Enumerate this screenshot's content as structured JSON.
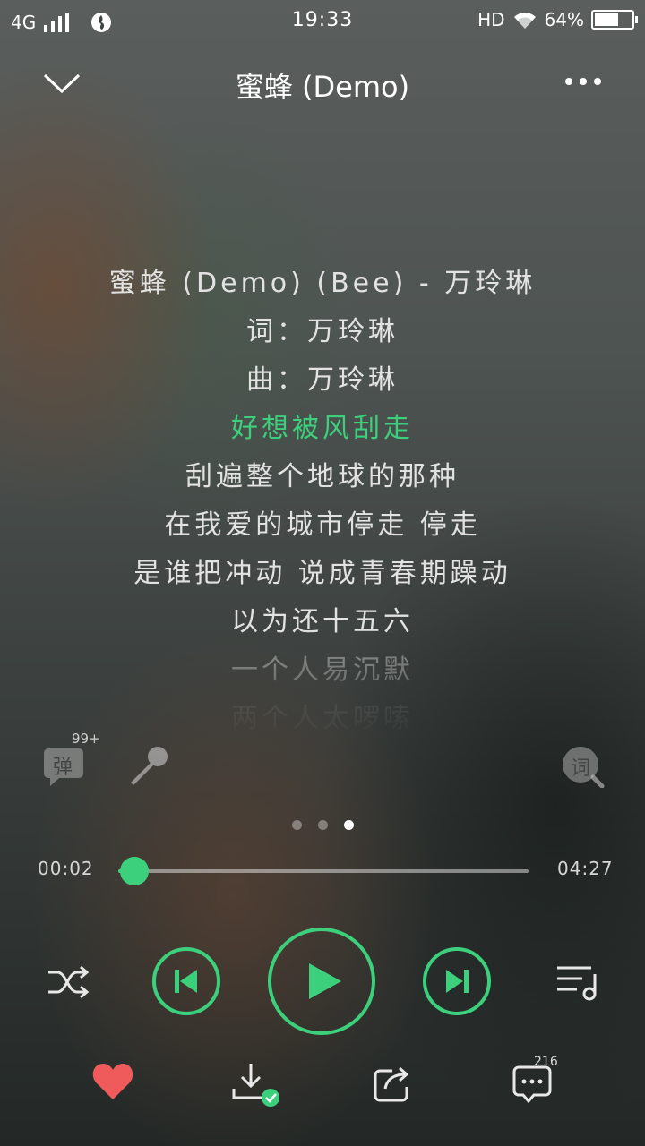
{
  "status_bar": {
    "network": "4G",
    "time": "19:33",
    "hd": "HD",
    "battery_text": "64%",
    "battery_level": 0.64
  },
  "header": {
    "title": "蜜蜂 (Demo)",
    "collapse_icon": "chevron-down-icon",
    "more_icon": "more-icon"
  },
  "lyrics": {
    "lines": [
      "蜜蜂 (Demo) (Bee) - 万玲琳",
      "词：万玲琳",
      "曲：万玲琳",
      "好想被风刮走",
      "刮遍整个地球的那种",
      "在我爱的城市停走 停走",
      "是谁把冲动 说成青春期躁动",
      "以为还十五六",
      "一个人易沉默",
      "两个人太啰嗦"
    ],
    "active_index": 3
  },
  "tools": {
    "danmaku_label": "弹",
    "danmaku_count": "99+",
    "lyrics_label": "词",
    "mic_icon": "microphone-icon"
  },
  "pager": {
    "count": 3,
    "active": 2
  },
  "progress": {
    "current": "00:02",
    "total": "04:27",
    "fraction": 0.008
  },
  "controls": {
    "shuffle_icon": "shuffle-icon",
    "prev_icon": "previous-icon",
    "play_icon": "play-icon",
    "next_icon": "next-icon",
    "playlist_icon": "playlist-icon"
  },
  "actions": {
    "like_icon": "heart-icon",
    "download_icon": "download-icon",
    "share_icon": "share-icon",
    "comment_icon": "comment-icon",
    "comment_count": "216"
  },
  "colors": {
    "accent": "#3dd07c",
    "like": "#ef5b5b"
  }
}
